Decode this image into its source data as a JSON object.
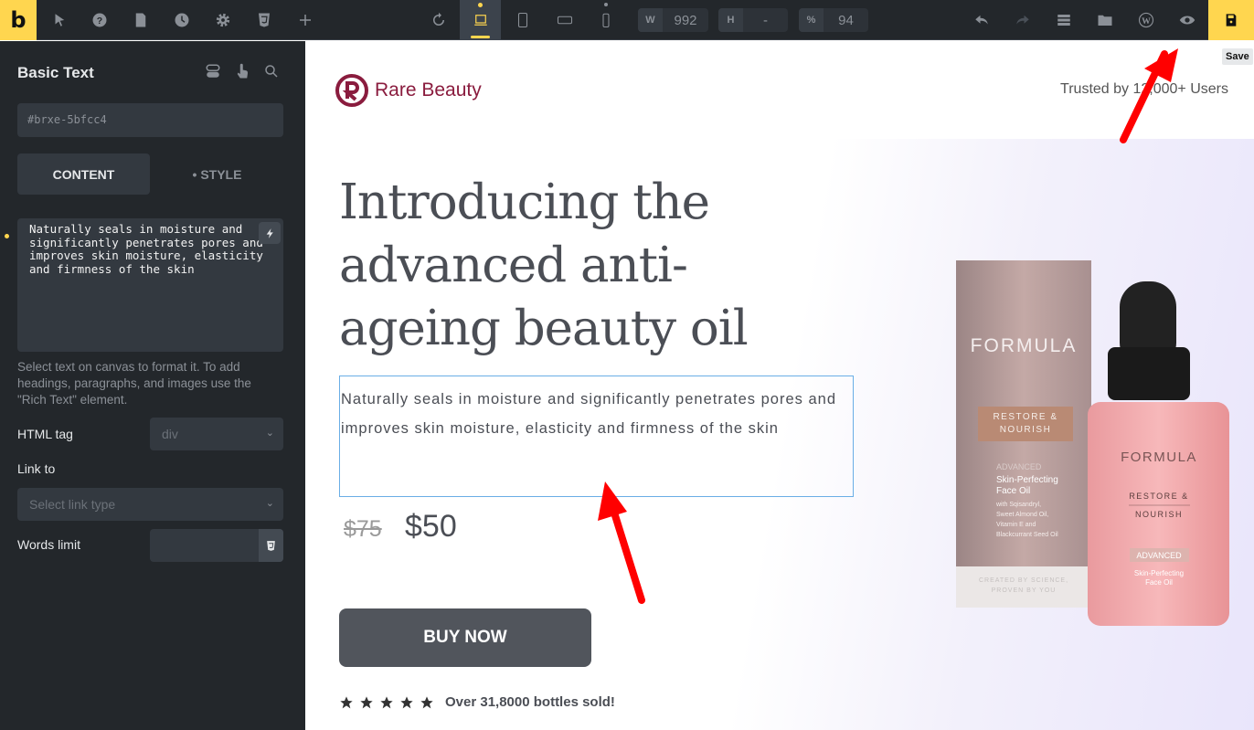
{
  "topbar": {
    "logo": "b",
    "width_label": "W",
    "width_value": "992",
    "height_label": "H",
    "height_value": "-",
    "zoom_label": "%",
    "zoom_value": "94",
    "save_tooltip": "Save",
    "accent": "#ffd64f"
  },
  "sidebar": {
    "title": "Basic Text",
    "element_id": "#brxe-5bfcc4",
    "tabs": [
      {
        "label": "CONTENT"
      },
      {
        "label": "• STYLE"
      }
    ],
    "text_value": "Naturally seals in moisture and significantly penetrates pores and improves skin moisture, elasticity and firmness of the skin",
    "hint": "Select text on canvas to format it. To add headings, paragraphs, and images use the \"Rich Text\" element.",
    "html_tag_label": "HTML tag",
    "html_tag_value": "div",
    "link_label": "Link to",
    "link_placeholder": "Select link type",
    "words_limit_label": "Words limit"
  },
  "page": {
    "brand": "Rare Beauty",
    "trusted": "Trusted by 12,000+ Users",
    "heading": "Introducing the advanced anti-ageing beauty oil",
    "description": "Naturally seals in moisture and significantly penetrates pores and improves skin moisture, elasticity and firmness of the skin",
    "old_price": "$75",
    "price": "$50",
    "buy_label": "BUY NOW",
    "rating": 5,
    "sold": "Over 31,8000 bottles sold!",
    "product_lettering": [
      "FORMULA",
      "RESTORE & NOURISH",
      "ADVANCED",
      "Skin-Perfecting Face Oil",
      "with Sqisandryl, Sweet Almond Oil, Vitamin E and Blackcurrant Seed Oil",
      "CREATED BY SCIENCE, PROVEN BY YOU"
    ],
    "brand_color": "#8a1c3e"
  }
}
